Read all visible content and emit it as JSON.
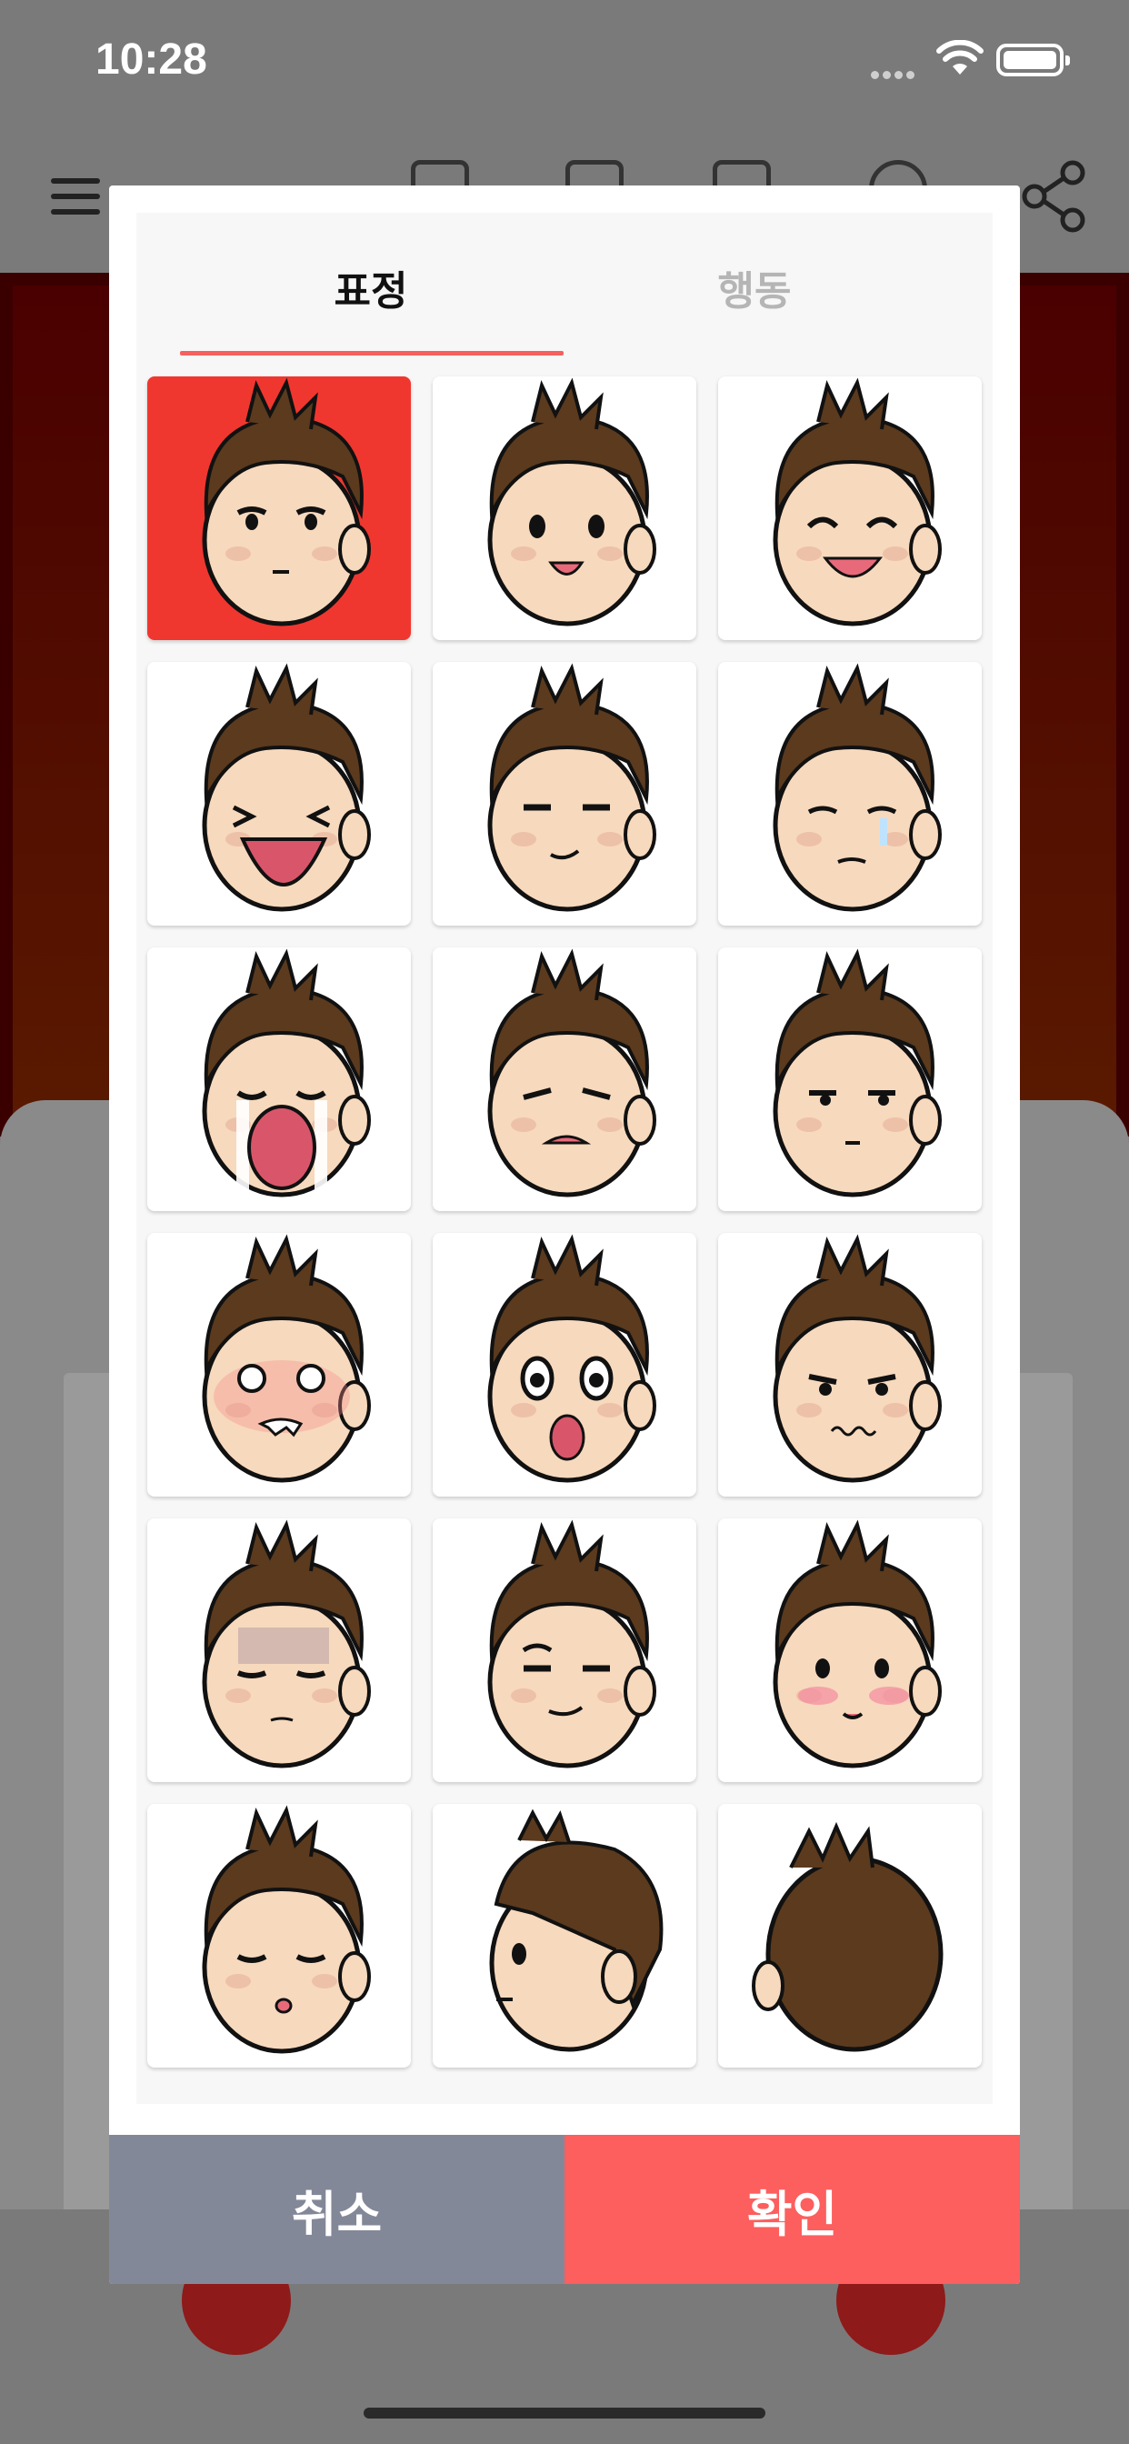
{
  "status_bar": {
    "time": "10:28"
  },
  "dialog": {
    "tabs": [
      {
        "label": "표정",
        "active": true
      },
      {
        "label": "행동",
        "active": false
      }
    ],
    "expressions": [
      {
        "name": "neutral",
        "selected": true
      },
      {
        "name": "smile",
        "selected": false
      },
      {
        "name": "laugh",
        "selected": false
      },
      {
        "name": "crying-laugh",
        "selected": false
      },
      {
        "name": "smug",
        "selected": false
      },
      {
        "name": "tearful",
        "selected": false
      },
      {
        "name": "wailing",
        "selected": false
      },
      {
        "name": "frustrated",
        "selected": false
      },
      {
        "name": "annoyed",
        "selected": false
      },
      {
        "name": "angry",
        "selected": false
      },
      {
        "name": "shocked",
        "selected": false
      },
      {
        "name": "worried",
        "selected": false
      },
      {
        "name": "gloomy",
        "selected": false
      },
      {
        "name": "sly",
        "selected": false
      },
      {
        "name": "blushing",
        "selected": false
      },
      {
        "name": "kiss",
        "selected": false
      },
      {
        "name": "side-view",
        "selected": false
      },
      {
        "name": "back-view",
        "selected": false
      }
    ],
    "cancel_label": "취소",
    "confirm_label": "확인"
  },
  "colors": {
    "accent": "#fd5e5e",
    "selected_cell": "#f0372f",
    "cancel": "#838898",
    "tab_inactive": "#b5b5b5",
    "hair": "#5b3a1e",
    "skin": "#f7d9bd"
  }
}
